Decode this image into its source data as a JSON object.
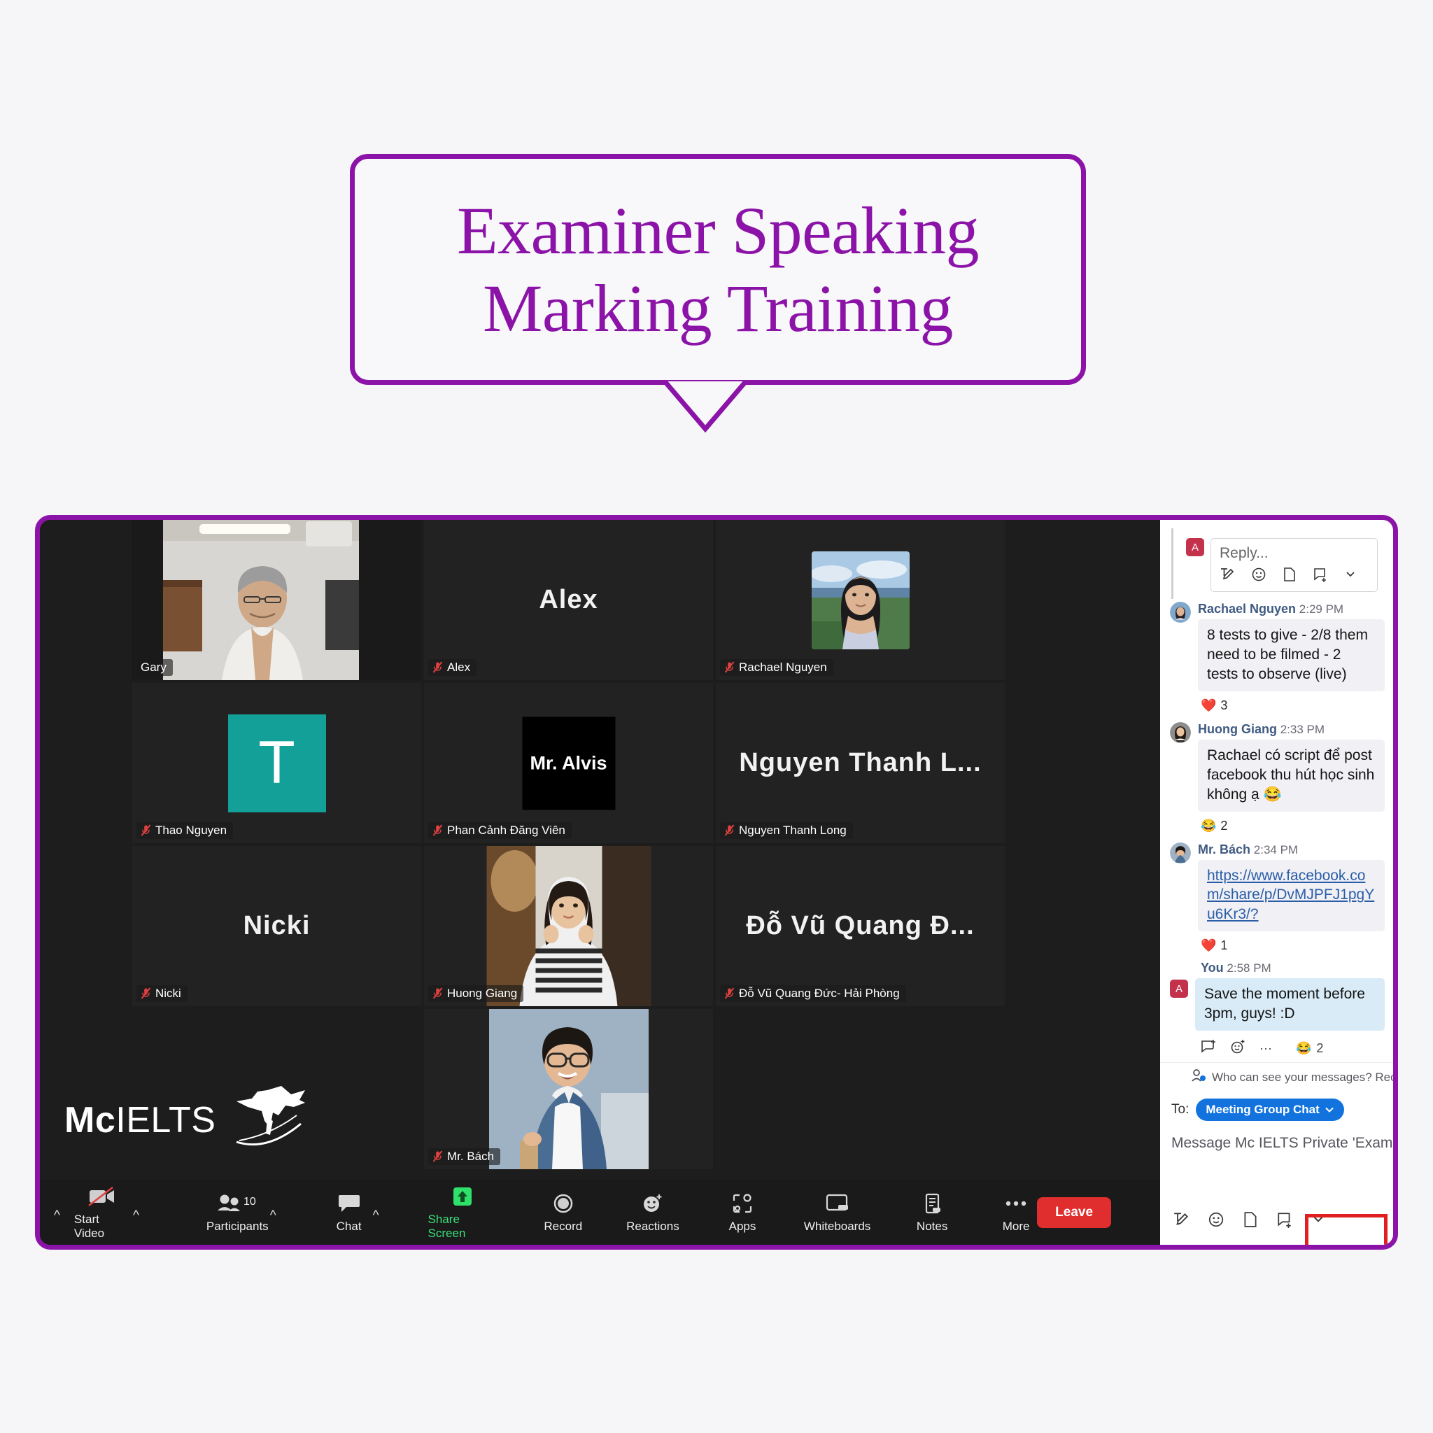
{
  "title_card": {
    "text": "Examiner Speaking\nMarking Training",
    "border_color": "#8c13a8",
    "text_color": "#8c13a8"
  },
  "meeting": {
    "frame_color": "#8c13a8",
    "active_speaker_color": "#e8e85a",
    "logo": {
      "mc": "Mc",
      "ielts": "IELTS",
      "bird_icon": "hummingbird-icon"
    },
    "participants": [
      {
        "name": "Gary",
        "display": "",
        "muted": false,
        "active_speaker": true,
        "tile_type": "video",
        "row": 1,
        "col": 1
      },
      {
        "name": "Alex",
        "display": "Alex",
        "muted": true,
        "active_speaker": false,
        "tile_type": "name",
        "row": 1,
        "col": 2
      },
      {
        "name": "Rachael Nguyen",
        "display": "",
        "muted": true,
        "active_speaker": false,
        "tile_type": "photo",
        "row": 1,
        "col": 3
      },
      {
        "name": "Thao Nguyen",
        "display": "T",
        "muted": true,
        "active_speaker": false,
        "tile_type": "letter-avatar",
        "avatar_color": "#13a098",
        "row": 2,
        "col": 1
      },
      {
        "name": "Phan Cảnh Đăng Viên",
        "display": "Mr. Alvis",
        "muted": true,
        "active_speaker": false,
        "tile_type": "black-avatar",
        "row": 2,
        "col": 2
      },
      {
        "name": "Nguyen Thanh Long",
        "display": "Nguyen Thanh L...",
        "muted": true,
        "active_speaker": false,
        "tile_type": "name",
        "row": 2,
        "col": 3
      },
      {
        "name": "Nicki",
        "display": "Nicki",
        "muted": true,
        "active_speaker": false,
        "tile_type": "name",
        "row": 3,
        "col": 1
      },
      {
        "name": "Huong Giang",
        "display": "",
        "muted": true,
        "active_speaker": false,
        "tile_type": "video",
        "row": 3,
        "col": 2
      },
      {
        "name": "Đỗ Vũ Quang Đức- Hải Phòng",
        "display": "Đỗ Vũ Quang Đ...",
        "muted": true,
        "active_speaker": false,
        "tile_type": "name",
        "row": 3,
        "col": 3
      },
      {
        "name": "Mr. Bách",
        "display": "",
        "muted": true,
        "active_speaker": false,
        "tile_type": "video",
        "row": 4,
        "col": 2
      }
    ],
    "toolbar": {
      "start_video": "Start Video",
      "participants": "Participants",
      "participants_count": "10",
      "chat": "Chat",
      "share_screen": "Share Screen",
      "record": "Record",
      "reactions": "Reactions",
      "apps": "Apps",
      "whiteboards": "Whiteboards",
      "notes": "Notes",
      "more": "More",
      "leave": "Leave",
      "share_screen_color": "#39e07a",
      "leave_color": "#e02d2d"
    }
  },
  "chat": {
    "reply": {
      "avatar_initial": "A",
      "placeholder": "Reply..."
    },
    "messages": [
      {
        "author": "Rachael Nguyen",
        "time": "2:29 PM",
        "text": "8 tests to give - 2/8 them need to be filmed - 2 tests to observe (live)",
        "mine": false,
        "is_link": false,
        "reaction": {
          "emoji": "❤️",
          "count": "3"
        }
      },
      {
        "author": "Huong Giang",
        "time": "2:33 PM",
        "text": "Rachael có script để post facebook thu hút học sinh không ạ 😂",
        "mine": false,
        "is_link": false,
        "reaction": {
          "emoji": "😂",
          "count": "2"
        }
      },
      {
        "author": "Mr. Bách",
        "time": "2:34 PM",
        "text": "https://www.facebook.com/share/p/DvMJPFJ1pgYu6Kr3/?",
        "mine": false,
        "is_link": true,
        "reaction": {
          "emoji": "❤️",
          "count": "1"
        }
      },
      {
        "author": "You",
        "time": "2:58 PM",
        "text": "Save the moment before 3pm, guys! :D",
        "mine": true,
        "is_link": false,
        "reaction": {
          "emoji": "😂",
          "count": "2"
        }
      }
    ],
    "privacy_note": "Who can see your messages? Record",
    "compose": {
      "to_label": "To:",
      "to_value": "Meeting Group Chat",
      "placeholder": "Message Mc IELTS Private 'Examine"
    }
  }
}
